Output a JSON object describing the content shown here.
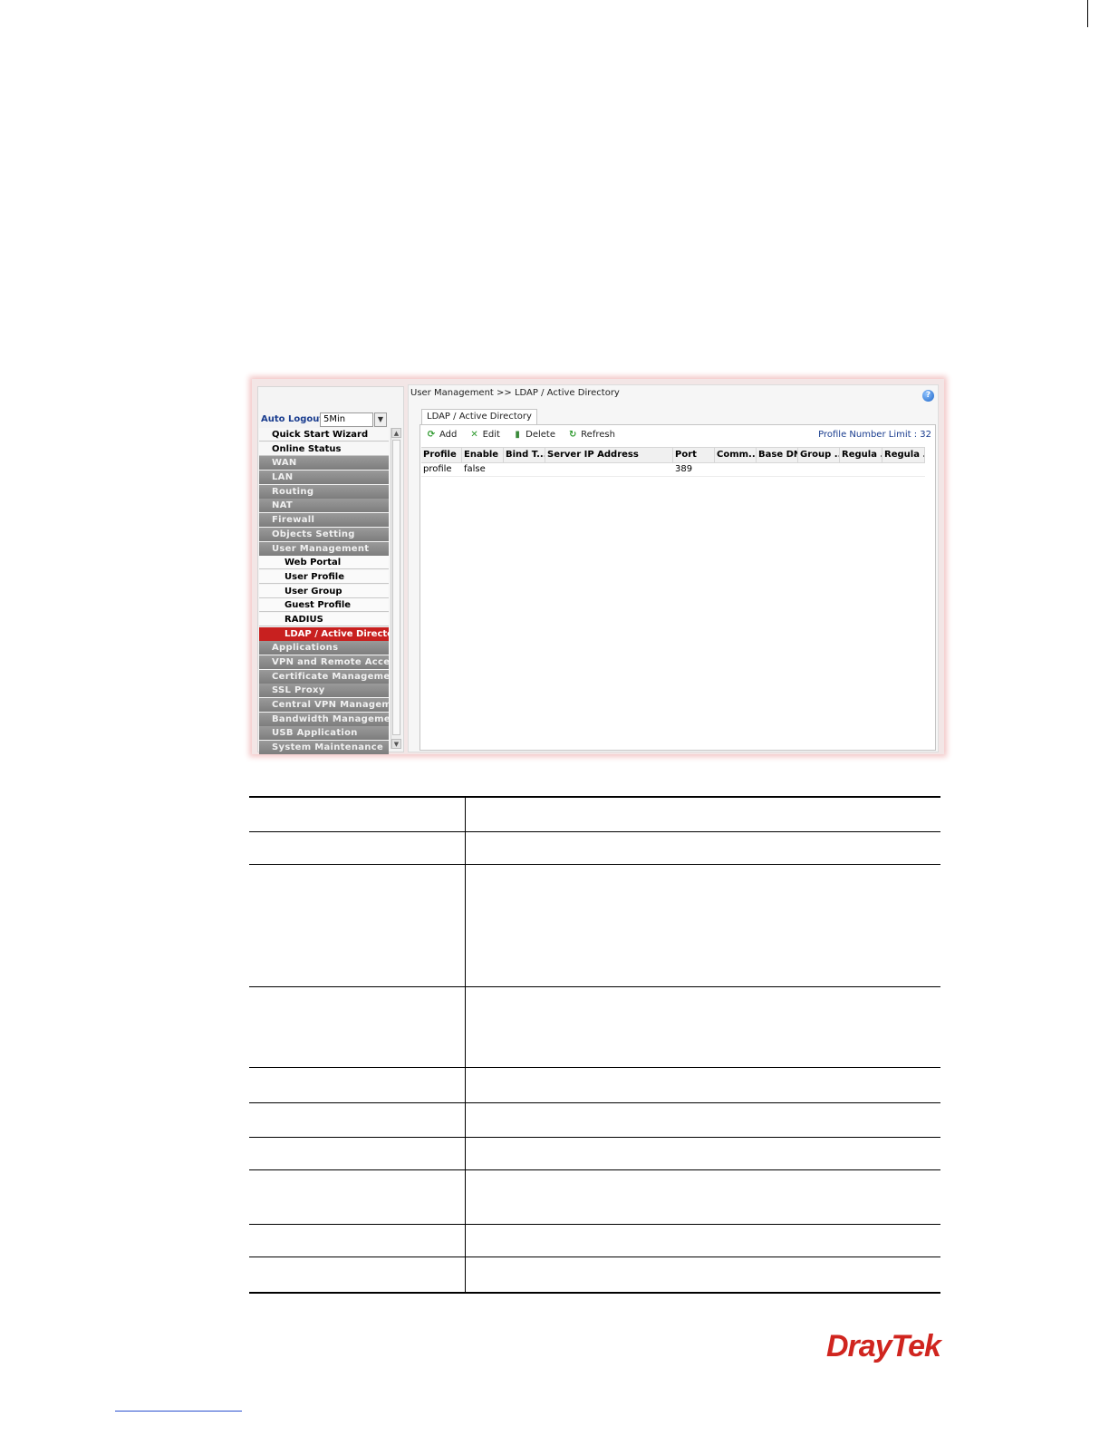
{
  "auto_logout": {
    "label": "Auto Logout :",
    "value": "5Min"
  },
  "menu": [
    {
      "label": "Quick Start Wizard",
      "style": "light"
    },
    {
      "label": "Online Status",
      "style": "light"
    },
    {
      "label": "WAN",
      "style": "dark"
    },
    {
      "label": "LAN",
      "style": "dark"
    },
    {
      "label": "Routing",
      "style": "dark"
    },
    {
      "label": "NAT",
      "style": "dark"
    },
    {
      "label": "Firewall",
      "style": "dark"
    },
    {
      "label": "Objects Setting",
      "style": "dark"
    },
    {
      "label": "User Management",
      "style": "dark"
    },
    {
      "label": "Web Portal",
      "style": "sub"
    },
    {
      "label": "User Profile",
      "style": "sub"
    },
    {
      "label": "User Group",
      "style": "sub"
    },
    {
      "label": "Guest Profile",
      "style": "sub"
    },
    {
      "label": "RADIUS",
      "style": "sub"
    },
    {
      "label": "LDAP / Active Directory",
      "style": "active"
    },
    {
      "label": "Applications",
      "style": "dark"
    },
    {
      "label": "VPN and Remote Access",
      "style": "dark"
    },
    {
      "label": "Certificate Management",
      "style": "dark"
    },
    {
      "label": "SSL Proxy",
      "style": "dark"
    },
    {
      "label": "Central VPN Managem...",
      "style": "dark"
    },
    {
      "label": "Bandwidth Management",
      "style": "dark"
    },
    {
      "label": "USB Application",
      "style": "dark"
    },
    {
      "label": "System Maintenance",
      "style": "dark"
    }
  ],
  "breadcrumb": "User Management >> LDAP / Active Directory",
  "help_icon": "help-icon",
  "tab_label": "LDAP / Active Directory",
  "toolbar": {
    "add": "Add",
    "edit": "Edit",
    "delete": "Delete",
    "refresh": "Refresh"
  },
  "profile_limit": "Profile Number Limit : 32",
  "grid": {
    "columns": [
      "Profile",
      "Enable",
      "Bind T...",
      "Server IP Address",
      "Port",
      "Comm...",
      "Base DN",
      "Group ...",
      "Regula ...",
      "Regula ..."
    ],
    "rows": [
      [
        "profile",
        "false",
        "",
        "",
        "389",
        "",
        "",
        "",
        "",
        ""
      ]
    ]
  },
  "logo_text": "DrayTek",
  "brand_color": "#d0251f",
  "active_color": "#c8201f"
}
